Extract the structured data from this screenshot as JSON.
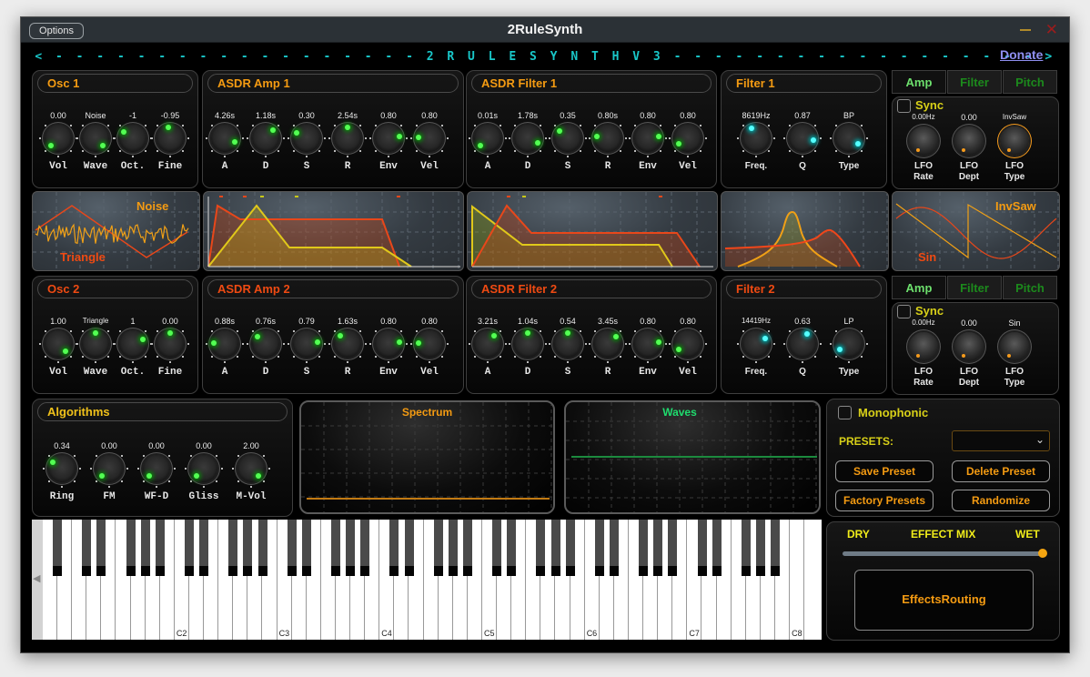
{
  "window": {
    "title": "2RuleSynth",
    "options_label": "Options",
    "minimize_icon": "minimize-icon",
    "close_icon": "close-icon",
    "close_glyph": "✕"
  },
  "banner": "< - - - - - - - - - - - - - - - - - - 2 R U L E S Y N T H   V 3 - - - - - - - - - - - - - - - - - - >",
  "donate_label": "Donate",
  "colors": {
    "orange": "#f49b12",
    "red_orange": "#ef4a12",
    "yellow": "#f0c11a",
    "knob_led_green": "#53ff53",
    "knob_led_cyan": "#55ffff",
    "banner_cyan": "#19c7c9",
    "waves_green": "#1c8a3e",
    "spectrum_orange": "#c27a12"
  },
  "osc1": {
    "title": "Osc 1",
    "knobs": [
      {
        "label": "Vol",
        "value": "0.00",
        "pos": 0.0
      },
      {
        "label": "Wave",
        "value": "Noise",
        "pos": 1.0
      },
      {
        "label": "Oct.",
        "value": "-1",
        "pos": 0.3
      },
      {
        "label": "Fine",
        "value": "-0.95",
        "pos": 0.47
      }
    ]
  },
  "asdr_amp1": {
    "title": "ASDR Amp 1",
    "knobs": [
      {
        "label": "A",
        "value": "4.26s",
        "pos": 0.9
      },
      {
        "label": "D",
        "value": "1.18s",
        "pos": 0.65
      },
      {
        "label": "S",
        "value": "0.30",
        "pos": 0.27
      },
      {
        "label": "R",
        "value": "2.54s",
        "pos": 0.5
      },
      {
        "label": "Env",
        "value": "0.80",
        "pos": 0.8
      },
      {
        "label": "Vel",
        "value": "0.80",
        "pos": 0.18
      }
    ]
  },
  "asdr_filter1": {
    "title": "ASDR Filter 1",
    "knobs": [
      {
        "label": "A",
        "value": "0.01s",
        "pos": 0.0
      },
      {
        "label": "D",
        "value": "1.78s",
        "pos": 0.92
      },
      {
        "label": "S",
        "value": "0.35",
        "pos": 0.32
      },
      {
        "label": "R",
        "value": "0.80s",
        "pos": 0.2
      },
      {
        "label": "Env",
        "value": "0.80",
        "pos": 0.8
      },
      {
        "label": "Vel",
        "value": "0.80",
        "pos": 0.05
      }
    ]
  },
  "filter1": {
    "title": "Filter 1",
    "knobs": [
      {
        "label": "Freq.",
        "value": "8619Hz",
        "pos": 0.4
      },
      {
        "label": "Q",
        "value": "0.87",
        "pos": 0.87
      },
      {
        "label": "Type",
        "value": "BP",
        "pos": 0.95
      }
    ]
  },
  "lfo1": {
    "tabs": [
      "Amp",
      "Filter",
      "Pitch"
    ],
    "active_tab": "Amp",
    "sync_label": "Sync",
    "sync_checked": false,
    "knobs": [
      {
        "label1": "LFO",
        "label2": "Rate",
        "value": "0.00Hz"
      },
      {
        "label1": "LFO",
        "label2": "Dept",
        "value": "0.00"
      },
      {
        "label1": "LFO",
        "label2": "Type",
        "value": "InvSaw"
      }
    ]
  },
  "osc1_display": {
    "wave_a": "Noise",
    "wave_b": "Triangle"
  },
  "lfo1_display": {
    "wave_a": "InvSaw",
    "wave_b": "Sin"
  },
  "osc2": {
    "title": "Osc 2",
    "knobs": [
      {
        "label": "Vol",
        "value": "1.00",
        "pos": 1.0
      },
      {
        "label": "Wave",
        "value": "Triangle",
        "pos": 0.5
      },
      {
        "label": "Oct.",
        "value": "1",
        "pos": 0.75
      },
      {
        "label": "Fine",
        "value": "0.00",
        "pos": 0.5
      }
    ]
  },
  "asdr_amp2": {
    "title": "ASDR Amp 2",
    "knobs": [
      {
        "label": "A",
        "value": "0.88s",
        "pos": 0.18
      },
      {
        "label": "D",
        "value": "0.76s",
        "pos": 0.33
      },
      {
        "label": "S",
        "value": "0.79",
        "pos": 0.8
      },
      {
        "label": "R",
        "value": "1.63s",
        "pos": 0.35
      },
      {
        "label": "Env",
        "value": "0.80",
        "pos": 0.8
      },
      {
        "label": "Vel",
        "value": "0.80",
        "pos": 0.18
      }
    ]
  },
  "asdr_filter2": {
    "title": "ASDR Filter 2",
    "knobs": [
      {
        "label": "A",
        "value": "3.21s",
        "pos": 0.64
      },
      {
        "label": "D",
        "value": "1.04s",
        "pos": 0.5
      },
      {
        "label": "S",
        "value": "0.54",
        "pos": 0.5
      },
      {
        "label": "R",
        "value": "3.45s",
        "pos": 0.69
      },
      {
        "label": "Env",
        "value": "0.80",
        "pos": 0.8
      },
      {
        "label": "Vel",
        "value": "0.80",
        "pos": 0.05
      }
    ]
  },
  "filter2": {
    "title": "Filter 2",
    "knobs": [
      {
        "label": "Freq.",
        "value": "14419Hz",
        "pos": 0.72
      },
      {
        "label": "Q",
        "value": "0.63",
        "pos": 0.6
      },
      {
        "label": "Type",
        "value": "LP",
        "pos": 0.05
      }
    ]
  },
  "lfo2": {
    "tabs": [
      "Amp",
      "Filter",
      "Pitch"
    ],
    "active_tab": "Amp",
    "sync_label": "Sync",
    "sync_checked": false,
    "knobs": [
      {
        "label1": "LFO",
        "label2": "Rate",
        "value": "0.00Hz"
      },
      {
        "label1": "LFO",
        "label2": "Dept",
        "value": "0.00"
      },
      {
        "label1": "LFO",
        "label2": "Type",
        "value": "Sin"
      }
    ]
  },
  "algorithms": {
    "title": "Algorithms",
    "knobs": [
      {
        "label": "Ring",
        "value": "0.34",
        "pos": 0.3
      },
      {
        "label": "FM",
        "value": "0.00",
        "pos": 0.0
      },
      {
        "label": "WF-D",
        "value": "0.00",
        "pos": 0.0
      },
      {
        "label": "Gliss",
        "value": "0.00",
        "pos": 0.0
      },
      {
        "label": "M-Vol",
        "value": "2.00",
        "pos": 1.0
      }
    ]
  },
  "spectrum": {
    "title": "Spectrum"
  },
  "waves": {
    "title": "Waves"
  },
  "presets": {
    "monophonic_label": "Monophonic",
    "monophonic_checked": false,
    "presets_label": "PRESETS:",
    "preset_selected": "",
    "save_label": "Save Preset",
    "delete_label": "Delete Preset",
    "factory_label": "Factory Presets",
    "randomize_label": "Randomize"
  },
  "effects": {
    "dry_label": "DRY",
    "mix_label": "EFFECT MIX",
    "wet_label": "WET",
    "mix_value": 1.0,
    "routing_label": "EffectsRouting"
  },
  "keyboard": {
    "octave_labels": [
      "C2",
      "C3",
      "C4",
      "C5",
      "C6",
      "C7",
      "C8"
    ],
    "scroll_icon": "scroll-left-icon"
  }
}
